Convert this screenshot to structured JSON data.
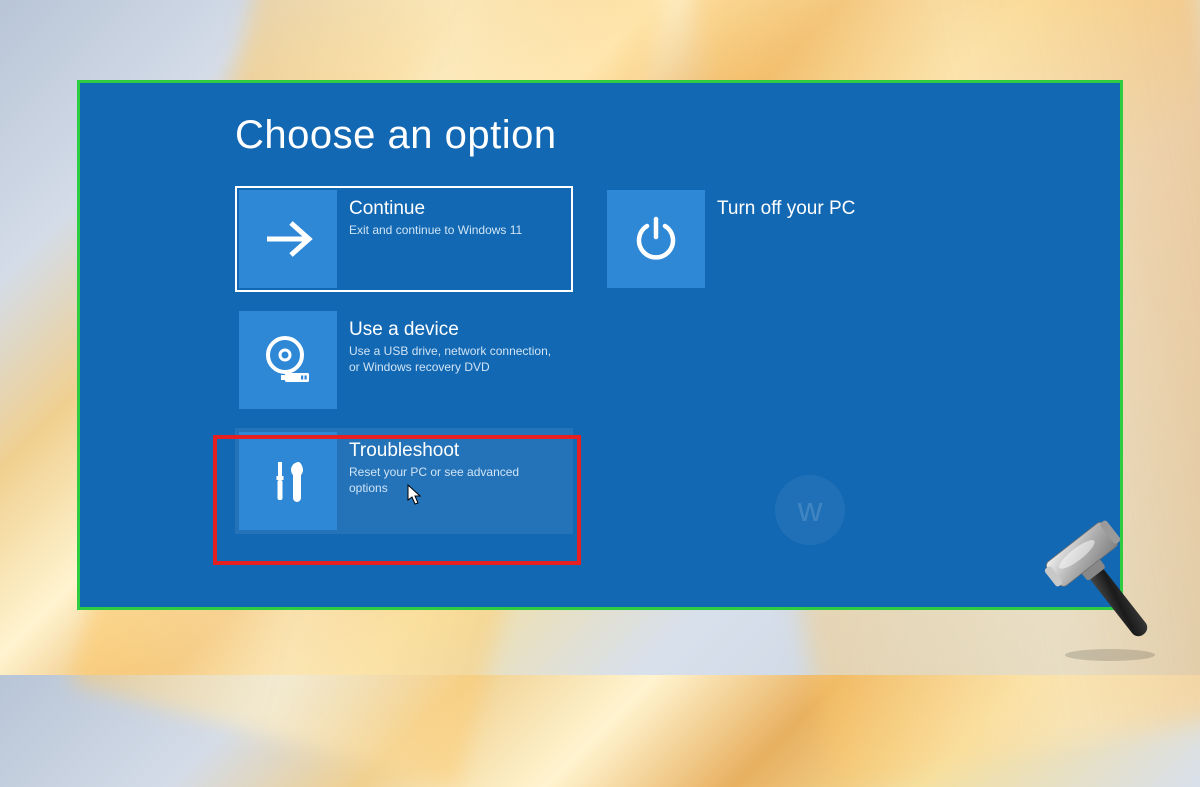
{
  "title": "Choose an option",
  "options": {
    "continue": {
      "title": "Continue",
      "desc": "Exit and continue to Windows 11"
    },
    "turnoff": {
      "title": "Turn off your PC",
      "desc": ""
    },
    "device": {
      "title": "Use a device",
      "desc": "Use a USB drive, network connection, or Windows recovery DVD"
    },
    "troubleshoot": {
      "title": "Troubleshoot",
      "desc": "Reset your PC or see advanced options"
    }
  },
  "watermark": "w"
}
